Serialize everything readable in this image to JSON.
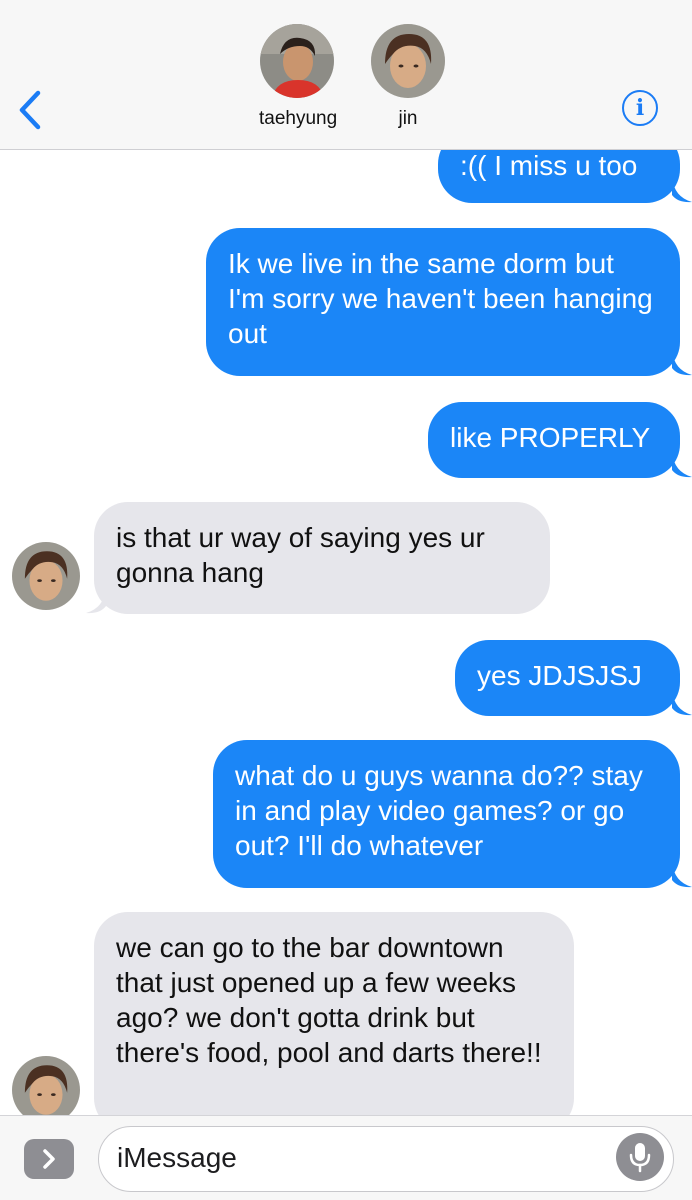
{
  "header": {
    "contacts": [
      {
        "name": "taehyung"
      },
      {
        "name": "jin"
      }
    ],
    "back_icon": "chevron-left-icon",
    "info_icon": "info-icon",
    "info_glyph": "i"
  },
  "messages": [
    {
      "from": "me",
      "text": ":(( I miss u too"
    },
    {
      "from": "me",
      "text": "Ik we live in the same dorm but I'm sorry we haven't been hanging out"
    },
    {
      "from": "me",
      "text": "like PROPERLY"
    },
    {
      "from": "jin",
      "text": "is that ur way of saying yes ur gonna hang"
    },
    {
      "from": "me",
      "text": "yes JDJSJSJ"
    },
    {
      "from": "me",
      "text": "what do u guys wanna do?? stay in and  play video games? or go out? I'll do whatever"
    },
    {
      "from": "jin",
      "text": "we can go to the bar downtown that just opened up a few weeks ago? we don't gotta drink but there's food, pool and darts there!!"
    }
  ],
  "composer": {
    "placeholder": "iMessage",
    "apps_icon": "chevron-right-icon",
    "mic_icon": "microphone-icon"
  },
  "colors": {
    "outgoing_bubble": "#1b86f7",
    "incoming_bubble": "#e6e6eb",
    "accent": "#1b7cf5"
  }
}
